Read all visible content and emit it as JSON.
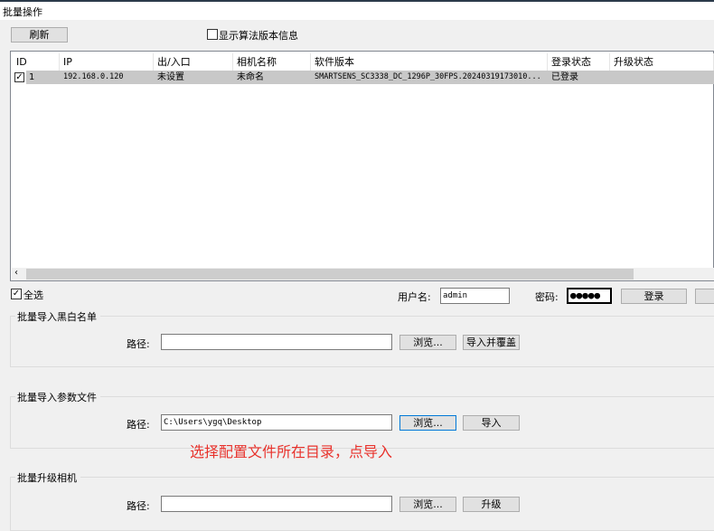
{
  "window": {
    "title": "批量操作"
  },
  "toolbar": {
    "refresh": "刷新",
    "show_algo_version": "显示算法版本信息",
    "show_algo_checked": false
  },
  "table": {
    "columns": [
      "ID",
      "IP",
      "出/入口",
      "相机名称",
      "软件版本",
      "登录状态",
      "升级状态"
    ],
    "rows": [
      {
        "checked": true,
        "id": "1",
        "ip": "192.168.0.120",
        "io": "未设置",
        "name": "未命名",
        "version": "SMARTSENS_SC3338_DC_1296P_30FPS.20240319173010...",
        "login": "已登录",
        "upgrade": ""
      }
    ]
  },
  "select_all": {
    "label": "全选",
    "checked": true
  },
  "login": {
    "username_label": "用户名:",
    "username": "admin",
    "password_label": "密码:",
    "password_mask": "●●●●●",
    "login_button": "登录"
  },
  "groups": [
    {
      "title": "批量导入黑白名单",
      "path_label": "路径:",
      "path": "",
      "browse": "浏览...",
      "action": "导入并覆盖"
    },
    {
      "title": "批量导入参数文件",
      "path_label": "路径:",
      "path": "C:\\Users\\ygq\\Desktop",
      "browse": "浏览...",
      "action": "导入"
    },
    {
      "title": "批量升级相机",
      "path_label": "路径:",
      "path": "",
      "browse": "浏览...",
      "action": "升级"
    }
  ],
  "annotation": "选择配置文件所在目录，点导入",
  "colors": {
    "annotation": "#e8322c",
    "selected_row": "#c8c8c8",
    "focus": "#0078d7"
  }
}
